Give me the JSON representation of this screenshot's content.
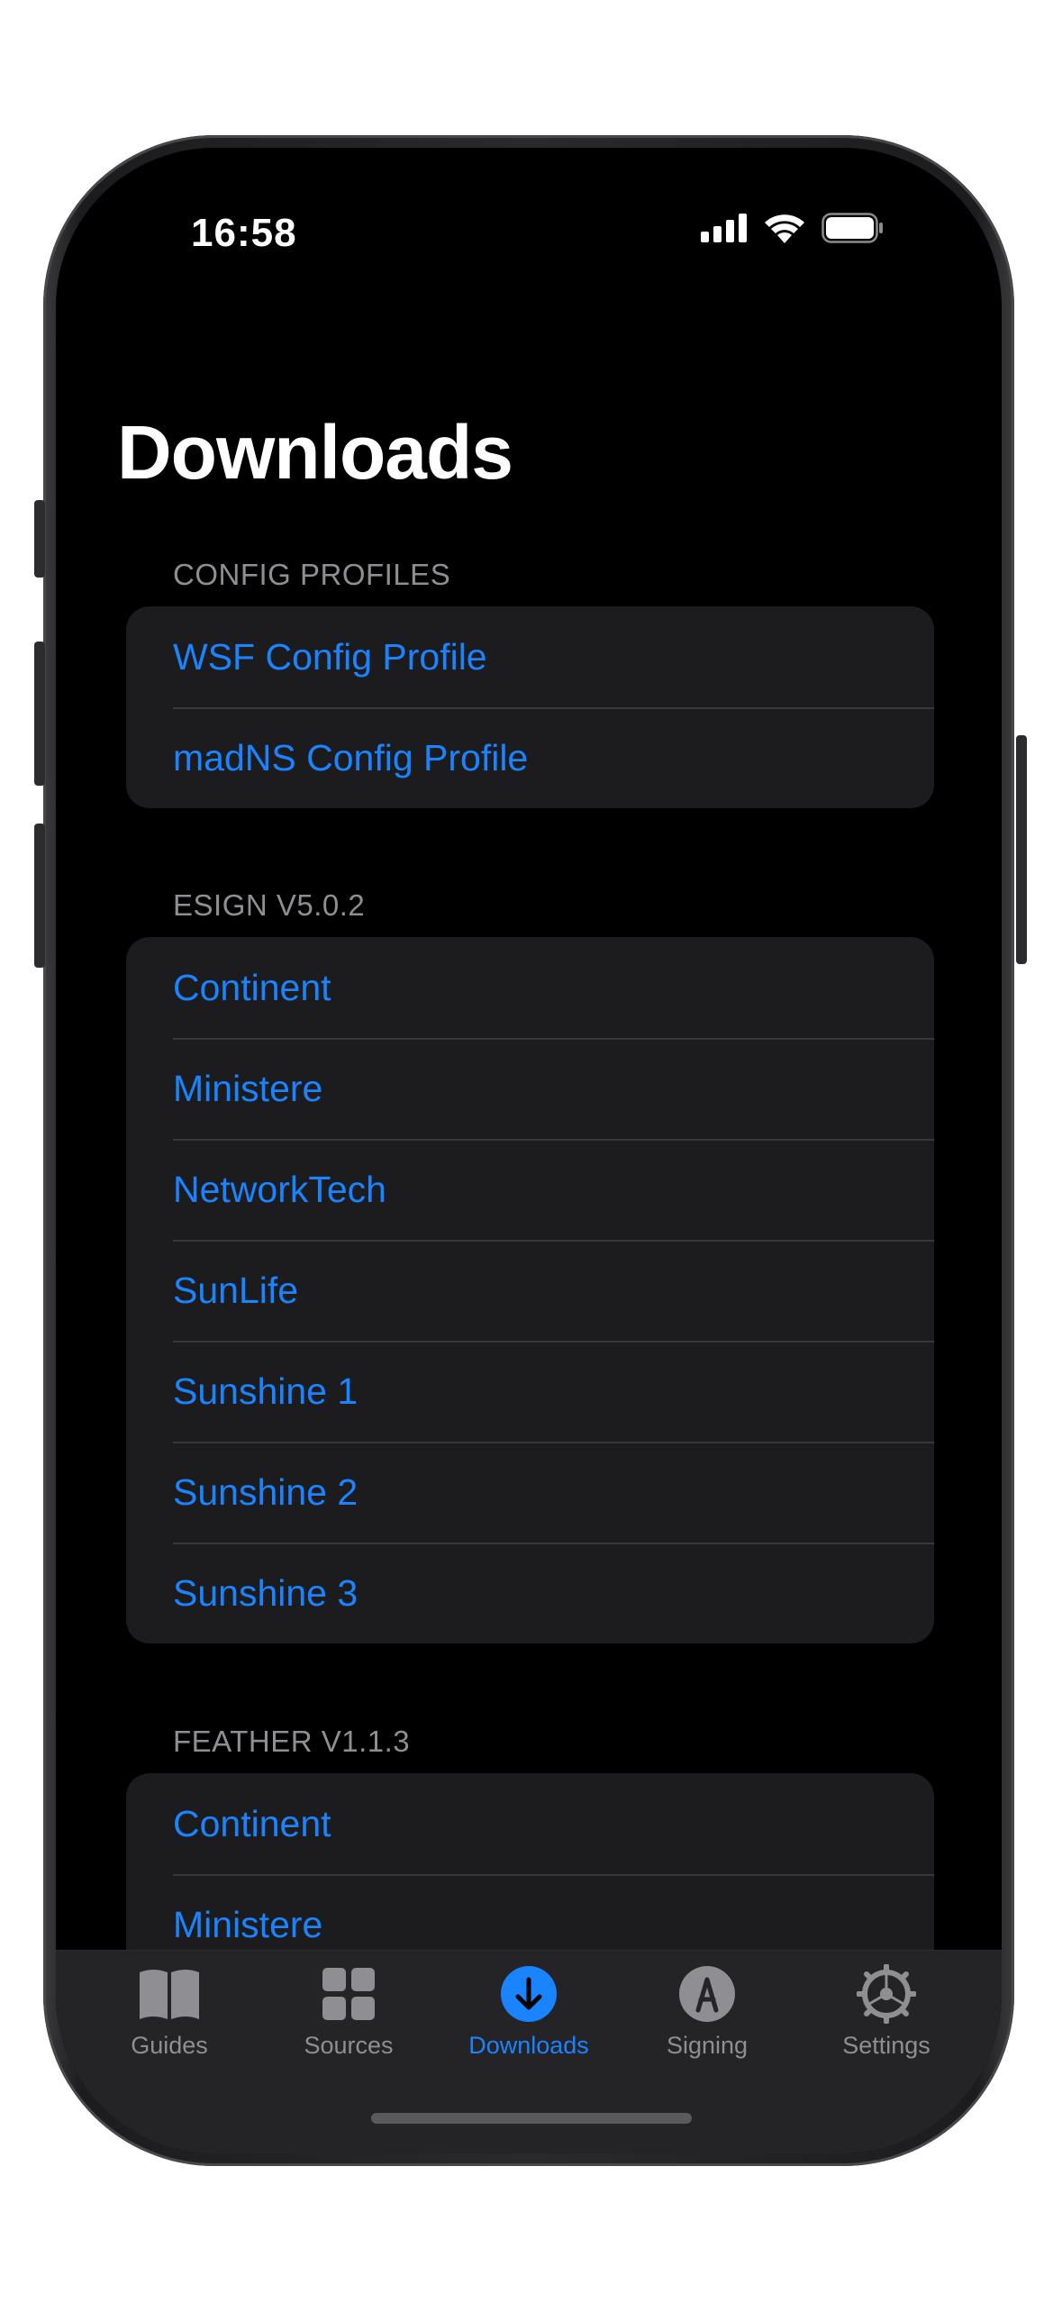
{
  "status_bar": {
    "time": "16:58",
    "icons": [
      "cellular-signal-icon",
      "wifi-icon",
      "battery-icon"
    ]
  },
  "page": {
    "title": "Downloads"
  },
  "sections": [
    {
      "header": "CONFIG PROFILES",
      "items": [
        "WSF Config Profile",
        "madNS Config Profile"
      ]
    },
    {
      "header": "ESIGN V5.0.2",
      "items": [
        "Continent",
        "Ministere",
        "NetworkTech",
        "SunLife",
        "Sunshine 1",
        "Sunshine 2",
        "Sunshine 3"
      ]
    },
    {
      "header": "FEATHER V1.1.3",
      "items": [
        "Continent",
        "Ministere"
      ]
    }
  ],
  "tab_bar": {
    "tabs": [
      {
        "label": "Guides",
        "icon": "book-icon",
        "active": false
      },
      {
        "label": "Sources",
        "icon": "grid-icon",
        "active": false
      },
      {
        "label": "Downloads",
        "icon": "download-arrow-icon",
        "active": true
      },
      {
        "label": "Signing",
        "icon": "app-store-icon",
        "active": false
      },
      {
        "label": "Settings",
        "icon": "gear-icon",
        "active": false
      }
    ]
  },
  "colors": {
    "accent": "#1a84ff",
    "background": "#000000",
    "group_background": "#1c1c1e",
    "secondary_text": "#8e8e93"
  }
}
